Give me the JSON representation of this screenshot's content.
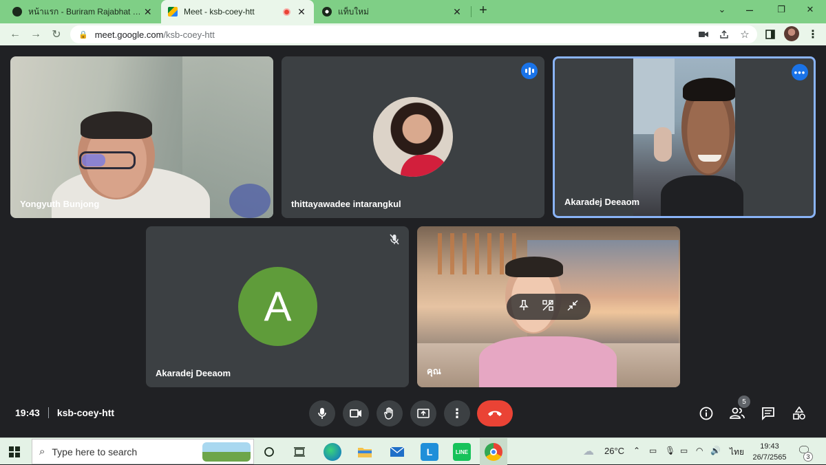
{
  "browser": {
    "tabs": [
      {
        "title": "หน้าแรก - Buriram Rajabhat Unive",
        "active": false,
        "favicon": "globe-icon"
      },
      {
        "title": "Meet - ksb-coey-htt",
        "active": true,
        "favicon": "meet-icon",
        "recording": true
      },
      {
        "title": "แท็บใหม่",
        "active": false,
        "favicon": "chrome-icon"
      }
    ],
    "url_host": "meet.google.com",
    "url_path": "/ksb-coey-htt"
  },
  "participants": [
    {
      "name": "Yongyuth Bunjong",
      "mode": "video"
    },
    {
      "name": "thittayawadee intarangkul",
      "mode": "photo",
      "speaking": true
    },
    {
      "name": "Akaradej Deeaom",
      "mode": "video",
      "pinned_highlight": true
    },
    {
      "name": "Akaradej Deeaom",
      "mode": "letter",
      "letter": "A",
      "muted": true,
      "avatar_color": "#5f9c3a"
    },
    {
      "name": "คุณ",
      "mode": "video",
      "self": true
    }
  ],
  "meeting": {
    "time": "19:43",
    "code": "ksb-coey-htt",
    "people_count": "5"
  },
  "colors": {
    "background": "#202124",
    "tile": "#3c4043",
    "end_call": "#ea4335",
    "accent": "#1a73e8",
    "highlight_border": "#8ab4f8"
  },
  "taskbar": {
    "search_placeholder": "Type here to search",
    "temperature": "26°C",
    "language": "ไทย",
    "clock_time": "19:43",
    "clock_date": "26/7/2565",
    "notification_count": "3"
  }
}
